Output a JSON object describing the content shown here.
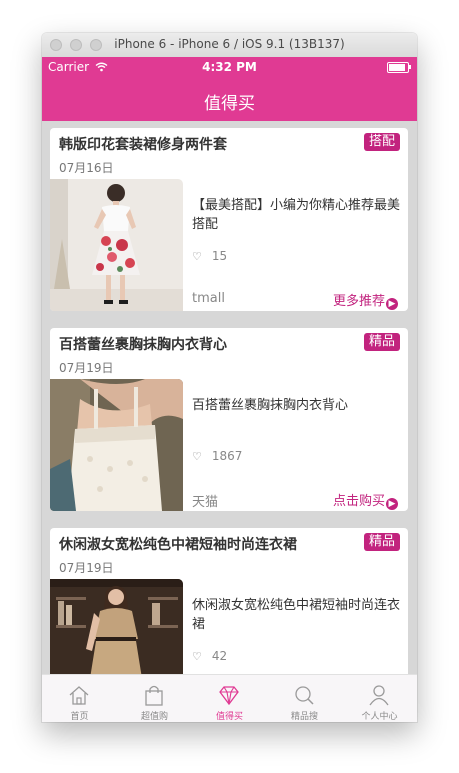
{
  "window": {
    "title": "iPhone 6 - iPhone 6 / iOS 9.1 (13B137)"
  },
  "status_bar": {
    "carrier": "Carrier",
    "time": "4:32 PM",
    "battery_level": 1.0
  },
  "nav": {
    "title": "值得买"
  },
  "accent_color": "#e03a93",
  "tag_color": "#c2237e",
  "cards": [
    {
      "title": "韩版印花套装裙修身两件套",
      "tag": "搭配",
      "date": "07月16日",
      "description": "【最美搭配】小编为你精心推荐最美搭配",
      "likes": "15",
      "store": "tmall",
      "action": "更多推荐",
      "image": "woman-in-floral-skirt-photo"
    },
    {
      "title": "百搭蕾丝裹胸抹胸内衣背心",
      "tag": "精品",
      "date": "07月19日",
      "description": "百搭蕾丝裹胸抹胸内衣背心",
      "likes": "1867",
      "store": "天猫",
      "action": "点击购买",
      "image": "lace-tube-top-photo"
    },
    {
      "title": "休闲淑女宽松纯色中裙短袖时尚连衣裙",
      "tag": "精品",
      "date": "07月19日",
      "description": "休闲淑女宽松纯色中裙短袖时尚连衣裙",
      "likes": "42",
      "store": "",
      "action": "",
      "image": "woman-in-khaki-dress-photo"
    }
  ],
  "tabs": [
    {
      "label": "首页",
      "icon": "home-icon",
      "active": false
    },
    {
      "label": "超值购",
      "icon": "shopping-bag-icon",
      "active": false
    },
    {
      "label": "值得买",
      "icon": "diamond-icon",
      "active": true
    },
    {
      "label": "精品搜",
      "icon": "search-icon",
      "active": false
    },
    {
      "label": "个人中心",
      "icon": "person-icon",
      "active": false
    }
  ]
}
